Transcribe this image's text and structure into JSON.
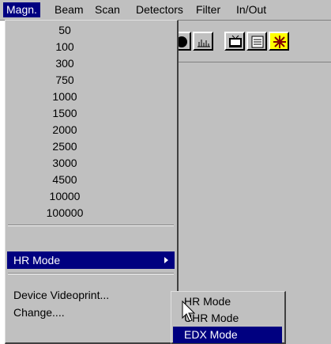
{
  "menubar": {
    "items": [
      {
        "label": "Magn.",
        "active": true
      },
      {
        "label": "Beam"
      },
      {
        "label": "Scan"
      },
      {
        "label": "Detectors"
      },
      {
        "label": "Filter"
      },
      {
        "label": "In/Out"
      }
    ]
  },
  "toolbar": {
    "icons": [
      "circle-icon",
      "histogram-icon",
      "monitor-icon",
      "list-icon",
      "snowflake-icon"
    ]
  },
  "magnification_menu": {
    "values": [
      "50",
      "100",
      "300",
      "750",
      "1000",
      "1500",
      "2000",
      "2500",
      "3000",
      "4500",
      "10000",
      "100000"
    ],
    "hr_mode_label": "HR Mode",
    "device_videoprint_label": "Device Videoprint...",
    "change_label": "Change...."
  },
  "hr_submenu": {
    "items": [
      {
        "label": "HR Mode"
      },
      {
        "label": "UHR Mode"
      },
      {
        "label": "EDX Mode",
        "selected": true
      }
    ]
  },
  "colors": {
    "highlight": "#000080",
    "face": "#c0c0c0"
  }
}
